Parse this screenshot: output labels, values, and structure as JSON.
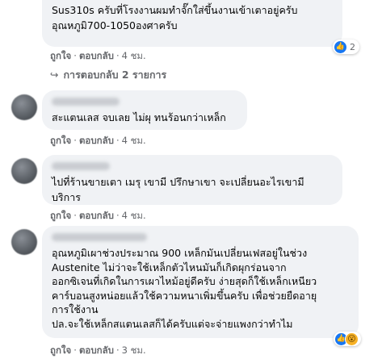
{
  "comments": [
    {
      "lines": [
        "Sus310s ครับที่โรงงานผมทำจั๊กใส่ขึ้นงานเข้าเตาอยู่ครับ",
        "อุณหภูมิ700-1050องศาครับ"
      ],
      "like": "ถูกใจ",
      "reply": "ตอบกลับ",
      "time": "4 ชม.",
      "reaction_count": "2"
    },
    {
      "lines": [
        "สะแตนเลส จบเลย ไม่ผุ ทนร้อนกว่าเหล็ก"
      ],
      "like": "ถูกใจ",
      "reply": "ตอบกลับ",
      "time": "4 ชม."
    },
    {
      "lines": [
        "ไปที่ร้านขายเตา เมรุ เขามี ปรึกษาเขา จะเปลี่ยนอะไรเขามี",
        "บริการ"
      ],
      "like": "ถูกใจ",
      "reply": "ตอบกลับ",
      "time": "4 ชม."
    },
    {
      "lines": [
        "อุณหภูมิเผาช่วงประมาณ 900 เหล็กมันเปลี่ยนเฟสอยู่ในช่วง",
        "Austenite ไม่ว่าจะใช้เหล็กตัวไหนมันก็เกิดผุกร่อนจาก",
        "ออกซิเจนที่เกิดในการเผาไหม้อยู่ดีครับ ง่ายสุดก็ใช้เหล็กเหนียว",
        "คาร์บอนสูงหน่อยแล้วใช้ความหนาเพิ่มขึ้นครับ เพื่อช่วยยืดอายุ",
        "การใช้งาน",
        "ปล.จะใช้เหล็กสแตนเลสก็ได้ครับแต่จะจ่ายแพงกว่าทำไม"
      ],
      "like": "ถูกใจ",
      "reply": "ตอบกลับ",
      "time": "3 ชม."
    }
  ],
  "replies_link": "การตอบกลับ 2 รายการ",
  "separator": "·",
  "icons": {
    "replies": "reply-arrow-icon",
    "like": "like-icon",
    "wow": "wow-icon"
  },
  "colors": {
    "bubble": "#f0f2f5",
    "meta": "#65676b",
    "like_blue": "#1877f2",
    "wow": "#f7b125"
  }
}
